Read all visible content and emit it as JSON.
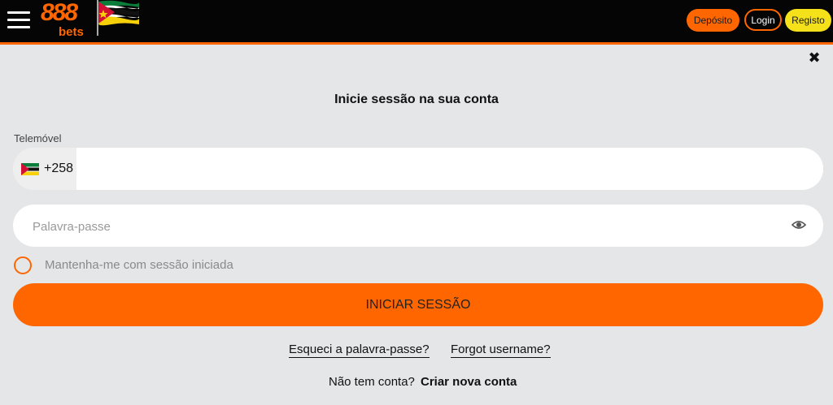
{
  "header": {
    "logo_number": "888",
    "logo_sub": "bets",
    "flag_icon": "mozambique-flag-icon",
    "deposit_label": "Depósito",
    "login_label": "Login",
    "register_label": "Registo",
    "colors": {
      "bar": "#050505",
      "accent": "#ff6600",
      "register": "#f5e11a"
    }
  },
  "modal": {
    "close_icon": "close-icon",
    "title": "Inicie sessão na sua conta",
    "phone": {
      "label": "Telemóvel",
      "country_flag": "mozambique-flag-icon",
      "prefix": "+258",
      "value": ""
    },
    "password": {
      "placeholder": "Palavra-passe",
      "toggle_icon": "eye-icon"
    },
    "remember_label": "Mantenha-me com sessão iniciada",
    "submit_label": "INICIAR SESSÃO",
    "forgot_password": "Esqueci a palavra-passe?",
    "forgot_username": "Forgot username?",
    "no_account": "Não tem conta?",
    "create_account": "Criar nova conta"
  }
}
